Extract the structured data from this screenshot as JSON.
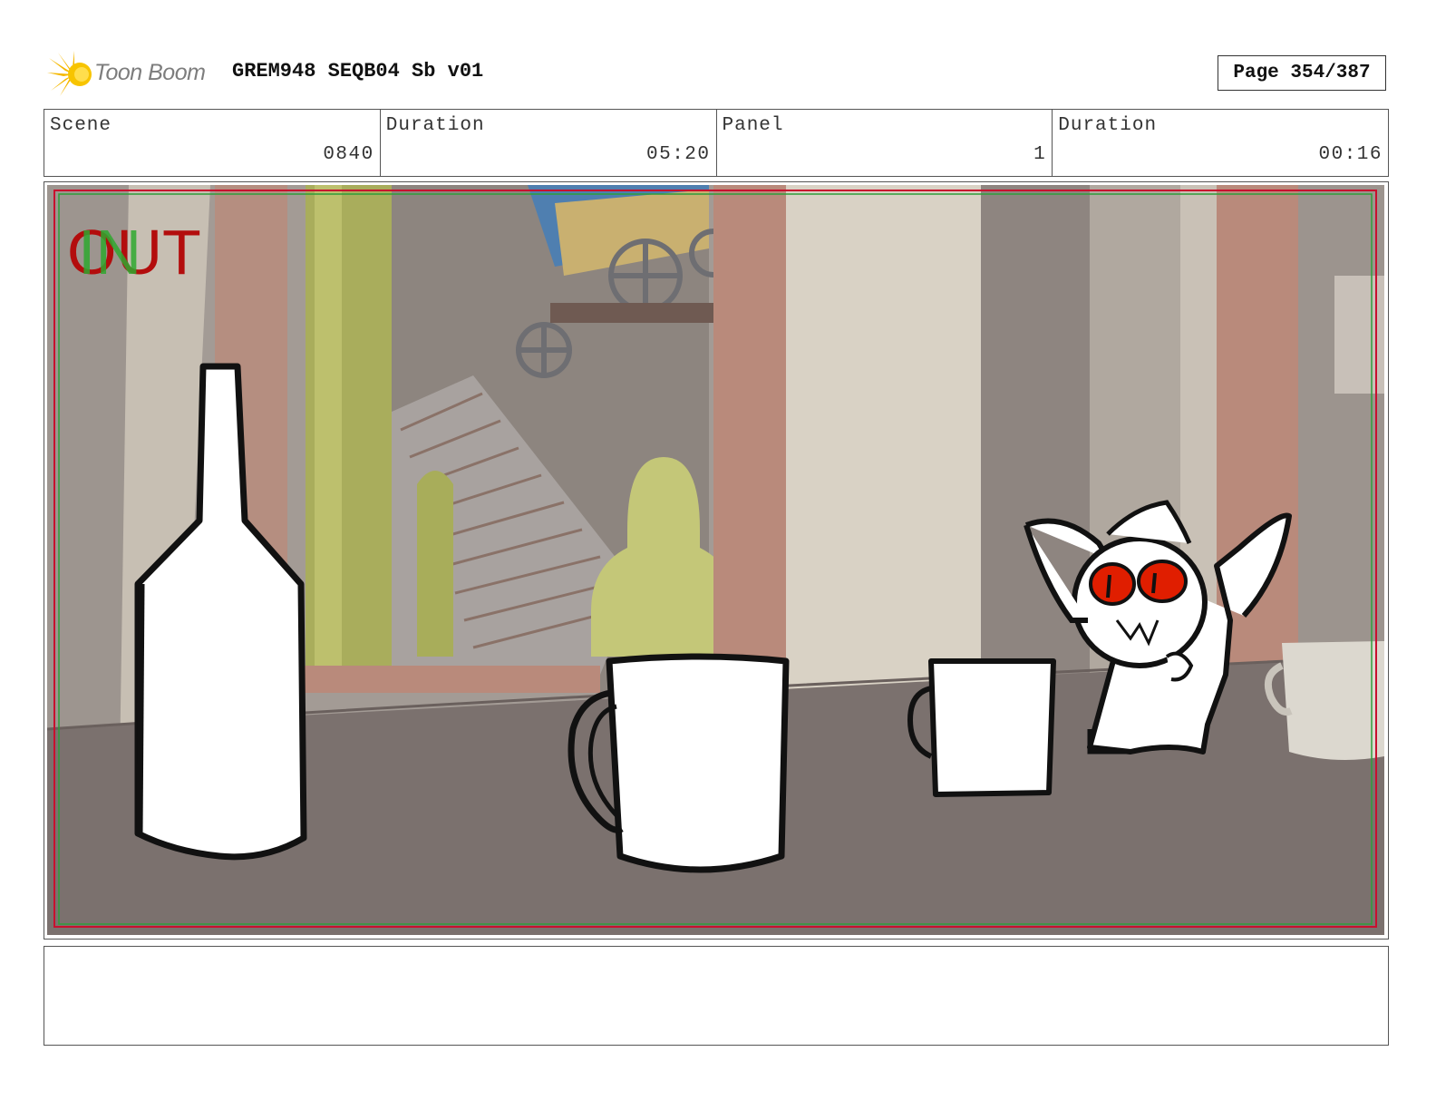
{
  "header": {
    "brand": "Toon Boom",
    "title": "GREM948 SEQB04 Sb v01",
    "page": "Page 354/387"
  },
  "info": {
    "scene_label": "Scene",
    "scene_value": "0840",
    "duration_label": "Duration",
    "duration_value": "05:20",
    "panel_label": "Panel",
    "panel_value": "1",
    "panel_duration_label": "Duration",
    "panel_duration_value": "00:16"
  },
  "panel": {
    "overlay_in": "IN",
    "overlay_out": "OUT",
    "colors": {
      "safe_frame_red": "#c8102e",
      "safe_frame_green": "#2e9e3a",
      "in_text": "#2fa82f",
      "out_text": "#b30d0d",
      "table": "#7b716e",
      "eyes": "#e01e00"
    },
    "icons": [
      "toon-boom-logo-icon"
    ]
  },
  "notes": {
    "text": ""
  }
}
